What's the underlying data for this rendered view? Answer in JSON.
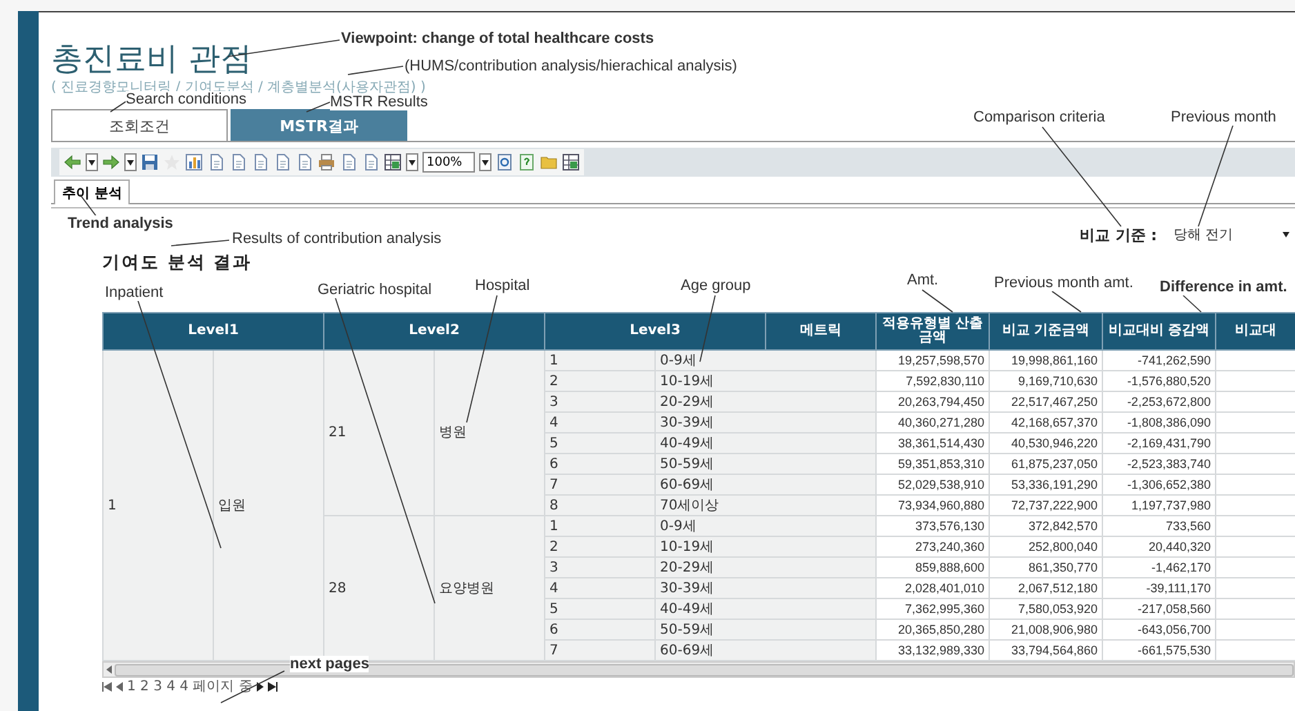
{
  "page": {
    "title": "총진료비 관점",
    "breadcrumb": "( 진료경향모니터링 / 기여도분석 / 계층별분석(사용자관점) )"
  },
  "tabs": [
    {
      "label": "조회조건",
      "selected": false
    },
    {
      "label": "MSTR결과",
      "selected": true
    }
  ],
  "toolbar": {
    "zoom": "100%"
  },
  "subtabs": [
    {
      "label": "추이 분석",
      "selected": true
    }
  ],
  "comparison": {
    "label": "비교 기준 :",
    "value": "당해 전기"
  },
  "section_title": "기여도 분석 결과",
  "table": {
    "columns": [
      "Level1",
      "Level2",
      "Level3",
      "메트릭",
      "적용유형별 산출금액",
      "비교 기준금액",
      "비교대비 증감액",
      "비교대"
    ],
    "groups": [
      {
        "id": "1",
        "name": "입원",
        "children": [
          {
            "id": "21",
            "name": "병원",
            "rows": [
              {
                "id": "1",
                "label": "0-9세",
                "amount": "19,257,598,570",
                "base": "19,998,861,160",
                "diff": "-741,262,590"
              },
              {
                "id": "2",
                "label": "10-19세",
                "amount": "7,592,830,110",
                "base": "9,169,710,630",
                "diff": "-1,576,880,520"
              },
              {
                "id": "3",
                "label": "20-29세",
                "amount": "20,263,794,450",
                "base": "22,517,467,250",
                "diff": "-2,253,672,800"
              },
              {
                "id": "4",
                "label": "30-39세",
                "amount": "40,360,271,280",
                "base": "42,168,657,370",
                "diff": "-1,808,386,090"
              },
              {
                "id": "5",
                "label": "40-49세",
                "amount": "38,361,514,430",
                "base": "40,530,946,220",
                "diff": "-2,169,431,790"
              },
              {
                "id": "6",
                "label": "50-59세",
                "amount": "59,351,853,310",
                "base": "61,875,237,050",
                "diff": "-2,523,383,740"
              },
              {
                "id": "7",
                "label": "60-69세",
                "amount": "52,029,538,910",
                "base": "53,336,191,290",
                "diff": "-1,306,652,380"
              },
              {
                "id": "8",
                "label": "70세이상",
                "amount": "73,934,960,880",
                "base": "72,737,222,900",
                "diff": "1,197,737,980"
              }
            ]
          },
          {
            "id": "28",
            "name": "요양병원",
            "rows": [
              {
                "id": "1",
                "label": "0-9세",
                "amount": "373,576,130",
                "base": "372,842,570",
                "diff": "733,560"
              },
              {
                "id": "2",
                "label": "10-19세",
                "amount": "273,240,360",
                "base": "252,800,040",
                "diff": "20,440,320"
              },
              {
                "id": "3",
                "label": "20-29세",
                "amount": "859,888,600",
                "base": "861,350,770",
                "diff": "-1,462,170"
              },
              {
                "id": "4",
                "label": "30-39세",
                "amount": "2,028,401,010",
                "base": "2,067,512,180",
                "diff": "-39,111,170"
              },
              {
                "id": "5",
                "label": "40-49세",
                "amount": "7,362,995,360",
                "base": "7,580,053,920",
                "diff": "-217,058,560"
              },
              {
                "id": "6",
                "label": "50-59세",
                "amount": "20,365,850,280",
                "base": "21,008,906,980",
                "diff": "-643,056,700"
              },
              {
                "id": "7",
                "label": "60-69세",
                "amount": "33,132,989,330",
                "base": "33,794,564,860",
                "diff": "-661,575,530"
              }
            ]
          }
        ]
      }
    ]
  },
  "pager": {
    "text": "1 2 3 4 4 페이지 중"
  },
  "annotations": [
    {
      "text": "Viewpoint: change of total healthcare costs",
      "bold": true
    },
    {
      "text": "(HUMS/contribution analysis/hierachical analysis)",
      "bold": false
    },
    {
      "text": "Search conditions",
      "bold": false
    },
    {
      "text": "MSTR Results",
      "bold": false
    },
    {
      "text": "Comparison criteria",
      "bold": false
    },
    {
      "text": "Previous month",
      "bold": false
    },
    {
      "text": "Trend analysis",
      "bold": true
    },
    {
      "text": "Results of contribution analysis",
      "bold": false
    },
    {
      "text": "Inpatient",
      "bold": false
    },
    {
      "text": "Geriatric hospital",
      "bold": false
    },
    {
      "text": "Hospital",
      "bold": false
    },
    {
      "text": "Age group",
      "bold": false
    },
    {
      "text": "Amt.",
      "bold": false
    },
    {
      "text": "Previous month amt.",
      "bold": false
    },
    {
      "text": "Difference in amt.",
      "bold": true
    },
    {
      "text": "next pages",
      "bold": true
    }
  ]
}
